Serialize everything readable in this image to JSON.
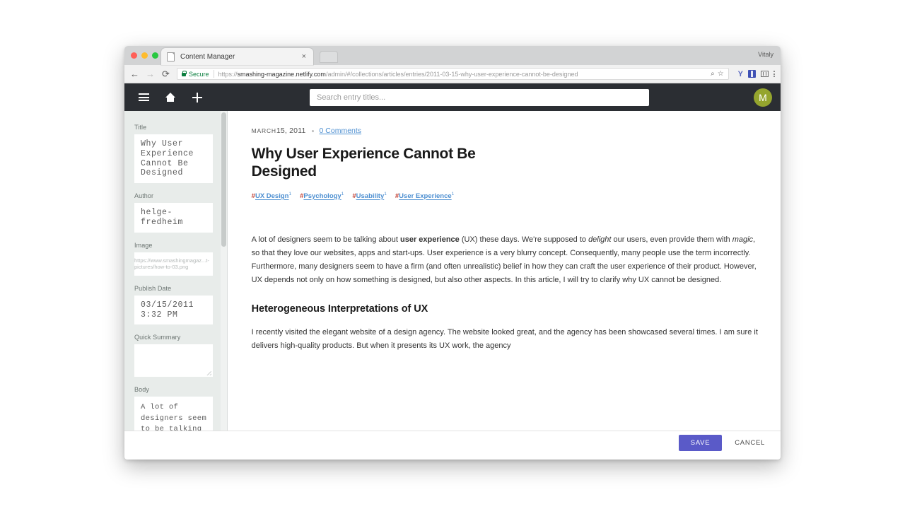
{
  "browser": {
    "tab": {
      "title": "Content Manager",
      "close_label": "×"
    },
    "nav": {
      "back": "←",
      "forward": "→",
      "reload": "⟳"
    },
    "omnibox": {
      "secure_label": "Secure",
      "url_scheme": "https://",
      "url_domain": "smashing-magazine.netlify.com",
      "url_path": "/admin/#/collections/articles/entries/2011-03-15-why-user-experience-cannot-be-designed",
      "search_icon": "⌕",
      "star_icon": "☆",
      "ext_y_label": "Y"
    },
    "profile_name": "Vitaly"
  },
  "toolbar": {
    "menu_icon": "hamburger-icon",
    "home_icon": "home-icon",
    "new_icon": "plus-icon",
    "search_placeholder": "Search entry titles...",
    "search_value": "",
    "avatar_initial": "M",
    "avatar_color": "#95a52e",
    "background": "#2b2e33"
  },
  "editor": {
    "fields": [
      {
        "label": "Title",
        "value": "Why User Experience Cannot Be Designed",
        "type": "text"
      },
      {
        "label": "Author",
        "value": "helge-fredheim",
        "type": "text"
      },
      {
        "label": "Image",
        "value": "https://www.smashingmagaz...t-pictures/how-to-03.png",
        "type": "image"
      },
      {
        "label": "Publish Date",
        "value": "03/15/2011 3:32 PM",
        "type": "text"
      },
      {
        "label": "Quick Summary",
        "value": "",
        "type": "textarea"
      },
      {
        "label": "Body",
        "type": "markdown"
      }
    ],
    "body_markdown": "A lot of designers seem to be talking about **user experience**\n(UX) these days. We're supposed to _delight_ our users, even\nprovide them with _magic_, so that they love our websites, apps\nand start-ups. User experience is a very blurry concept.\nConsequently, many people use the term incorrectly. Furthermore,\nmany designers seem to have a firm (and often unrealistic) belief\nin how they can craft the user experience of their product.\nHowever, UX depends not only on how something is designed, but\nalso other aspects. In this article, I will try to clarify why UX\ncannot be designed."
  },
  "preview": {
    "date_month": "MARCH",
    "date_rest": "15, 2011",
    "comments": "0 Comments",
    "title": "Why User Experience Cannot Be Designed",
    "tags": [
      {
        "hash": "#",
        "name": "UX Design",
        "sup": "1"
      },
      {
        "hash": "#",
        "name": "Psychology",
        "sup": "1"
      },
      {
        "hash": "#",
        "name": "Usability",
        "sup": "1"
      },
      {
        "hash": "#",
        "name": "User Experience",
        "sup": "1"
      }
    ],
    "paragraph_1_a": "A lot of designers seem to be talking about ",
    "paragraph_1_bold": "user experience",
    "paragraph_1_b": " (UX) these days. We're supposed to ",
    "paragraph_1_em1": "delight",
    "paragraph_1_c": " our users, even provide them with ",
    "paragraph_1_em2": "magic",
    "paragraph_1_d": ", so that they love our websites, apps and start-ups. User experience is a very blurry concept. Consequently, many people use the term incorrectly. Furthermore, many designers seem to have a firm (and often unrealistic) belief in how they can craft the user experience of their product. However, UX depends not only on how something is designed, but also other aspects. In this article, I will try to clarify why UX cannot be designed.",
    "heading_2": "Heterogeneous Interpretations of UX",
    "paragraph_2": "I recently visited the elegant website of a design agency. The website looked great, and the agency has been showcased several times. I am sure it delivers high-quality products. But when it presents its UX work, the agency"
  },
  "actions": {
    "save_label": "SAVE",
    "cancel_label": "CANCEL",
    "save_color": "#5a5ac8"
  }
}
